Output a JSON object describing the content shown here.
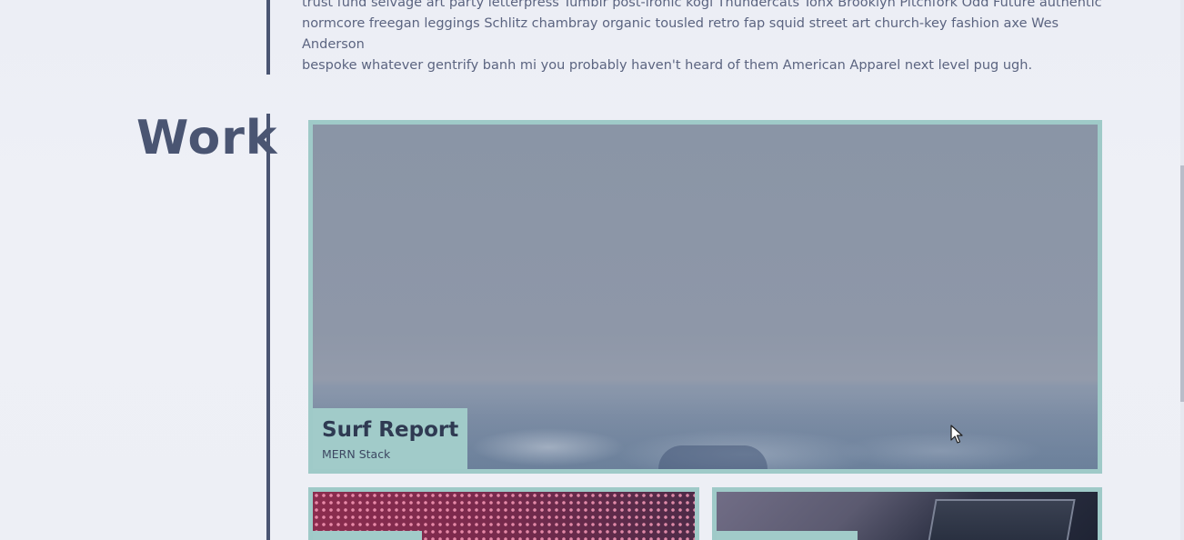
{
  "about": {
    "text_line1": "trust fund selvage art party letterpress Tumblr post-ironic kogi Thundercats Tonx Brooklyn Pitchfork Odd Future authentic",
    "text_line2": "normcore freegan leggings Schlitz chambray organic tousled retro fap squid street art church-key fashion axe Wes Anderson",
    "text_line3": "bespoke whatever gentrify banh mi you probably haven't heard of them American Apparel next level pug ugh."
  },
  "work": {
    "title": "Work",
    "featured": {
      "title": "Surf Report",
      "subtitle": "MERN Stack"
    }
  },
  "colors": {
    "accent": "#9fcac8",
    "heading": "#4a5572",
    "text": "#5b6480",
    "background": "#eef0f6"
  },
  "icons": {
    "cursor": "mouse-pointer-icon"
  }
}
